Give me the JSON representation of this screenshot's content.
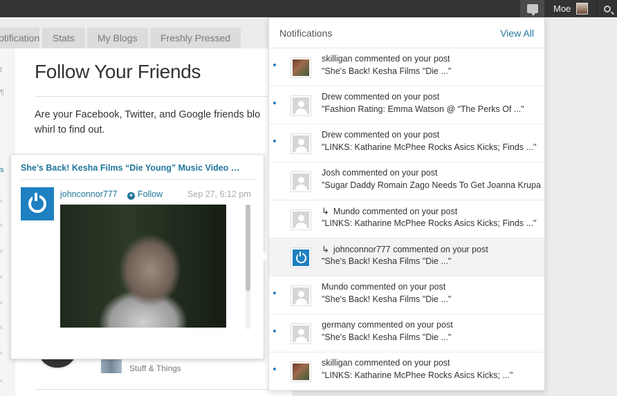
{
  "topbar": {
    "user_name": "Moe"
  },
  "tabs": [
    {
      "label": "Notifications"
    },
    {
      "label": "Stats"
    },
    {
      "label": "My Blogs"
    },
    {
      "label": "Freshly Pressed"
    }
  ],
  "main": {
    "title": "Follow Your Friends",
    "intro_line1": "Are your Facebook, Twitter, and Google friends blo",
    "intro_line2": "whirl to find out.",
    "bottom_label": "Stuff & Things"
  },
  "hover_card": {
    "post_title": "She’s Back! Kesha Films “Die Young” Music Video …",
    "username": "johnconnor777",
    "follow_label": "Follow",
    "date": "Sep 27, 6:12 pm"
  },
  "notifications": {
    "title": "Notifications",
    "view_all": "View All",
    "items": [
      {
        "unread": true,
        "avatar": "photo",
        "reply": false,
        "line1": "skilligan commented on your post",
        "line2": "\"She's Back! Kesha Films \"Die ...\""
      },
      {
        "unread": true,
        "avatar": "default",
        "reply": false,
        "line1": "Drew commented on your post",
        "line2": "\"Fashion Rating: Emma Watson @ “The Perks Of ...\""
      },
      {
        "unread": true,
        "avatar": "default",
        "reply": false,
        "line1": "Drew commented on your post",
        "line2": "\"LINKS: Katharine McPhee Rocks Asics Kicks; Finds ...\""
      },
      {
        "unread": false,
        "avatar": "default",
        "reply": false,
        "line1": "Josh commented on your post",
        "line2": "\"Sugar Daddy Romain Zago Needs To Get Joanna Krupa"
      },
      {
        "unread": false,
        "avatar": "default",
        "reply": true,
        "line1": "Mundo commented on your post",
        "line2": "\"LINKS: Katharine McPhee Rocks Asics Kicks; Finds ...\""
      },
      {
        "unread": false,
        "avatar": "blue",
        "reply": true,
        "line1": "johnconnor777 commented on your post",
        "line2": "\"She's Back! Kesha Films \"Die ...\""
      },
      {
        "unread": true,
        "avatar": "default",
        "reply": false,
        "line1": "Mundo commented on your post",
        "line2": "\"She's Back! Kesha Films \"Die ...\""
      },
      {
        "unread": true,
        "avatar": "default",
        "reply": false,
        "line1": "germany commented on your post",
        "line2": "\"She's Back! Kesha Films \"Die ...\""
      },
      {
        "unread": true,
        "avatar": "photo",
        "reply": false,
        "line1": "skilligan commented on your post",
        "line2": "\"LINKS: Katharine McPhee Rocks Asics Kicks; ...\""
      }
    ]
  }
}
